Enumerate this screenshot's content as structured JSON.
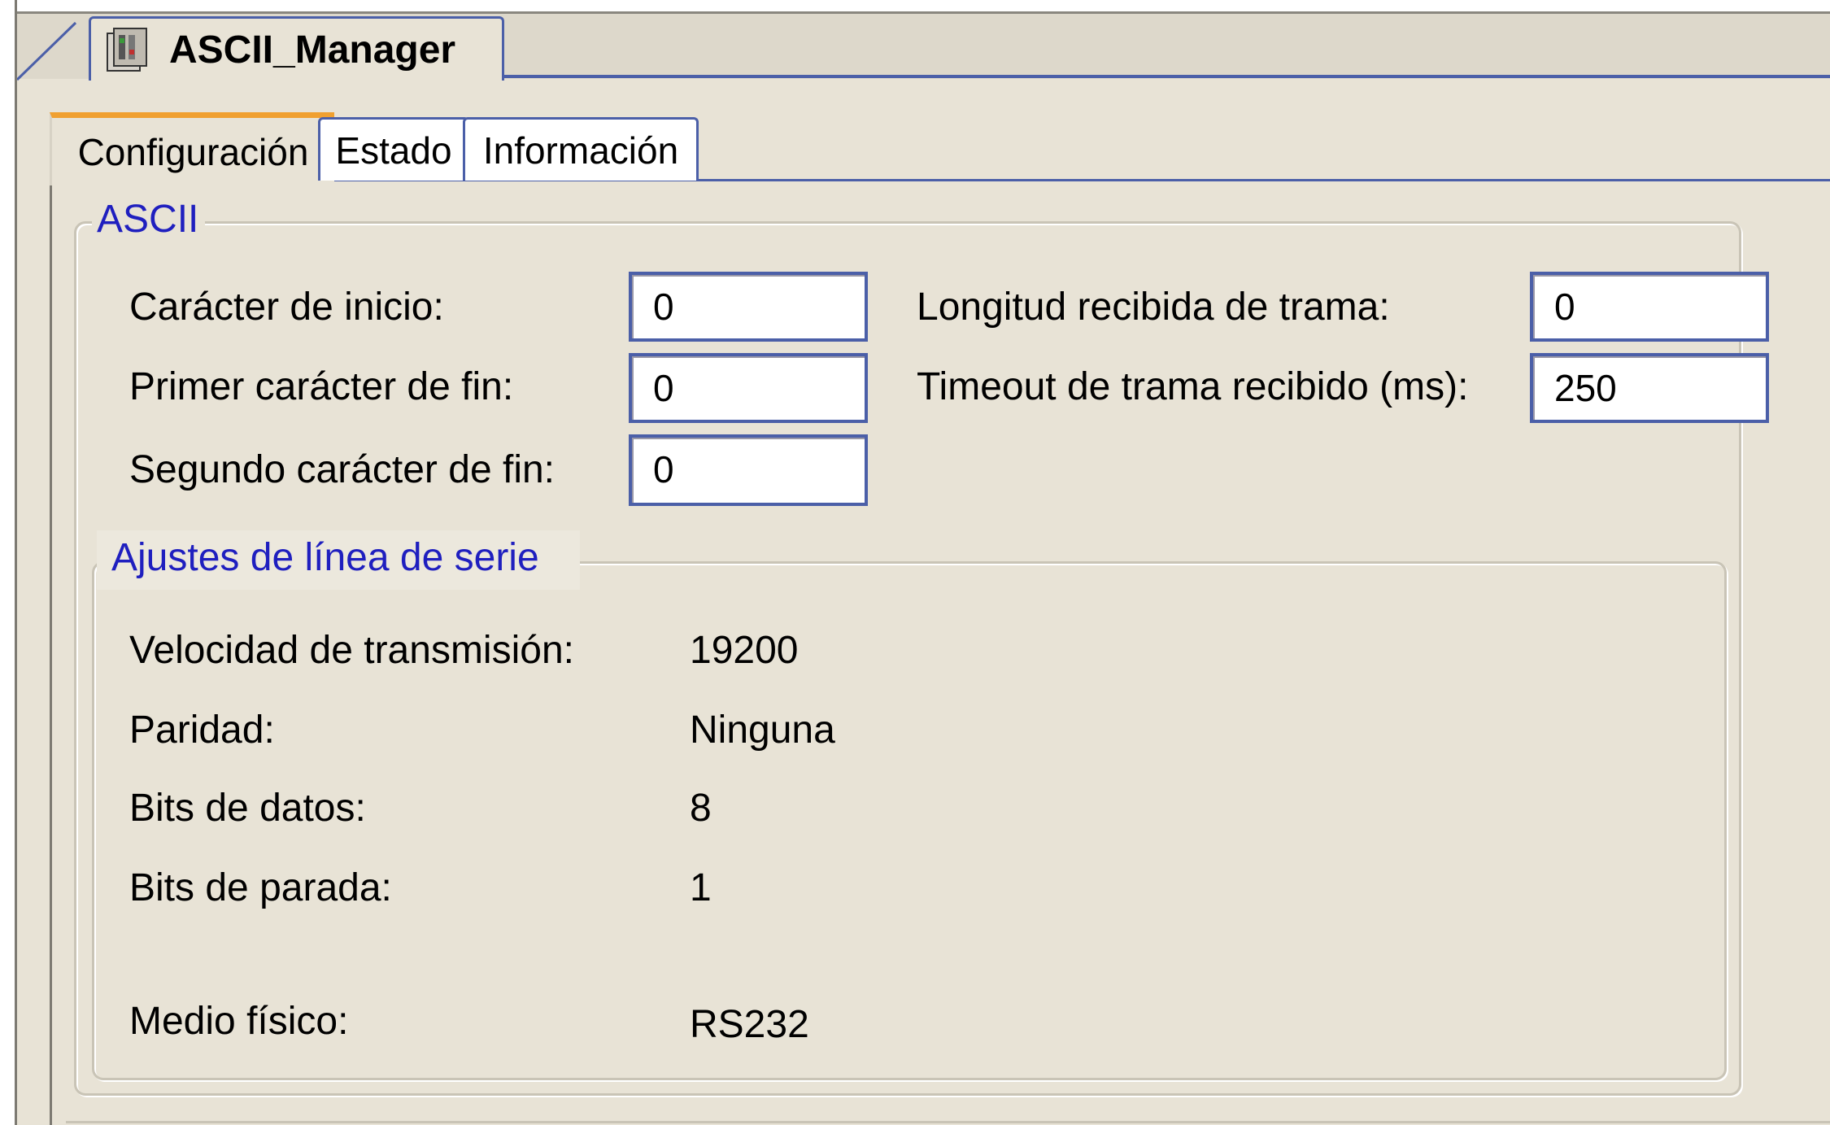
{
  "editor_tab": {
    "title": "ASCII_Manager",
    "icon": "module-icon"
  },
  "tabs": [
    {
      "label": "Configuración",
      "active": true
    },
    {
      "label": "Estado",
      "active": false
    },
    {
      "label": "Información",
      "active": false
    }
  ],
  "ascii": {
    "legend": "ASCII",
    "start_char": {
      "label": "Carácter de inicio:",
      "value": "0"
    },
    "first_end_char": {
      "label": "Primer carácter de fin:",
      "value": "0"
    },
    "second_end_char": {
      "label": "Segundo carácter de fin:",
      "value": "0"
    },
    "frame_length": {
      "label": "Longitud recibida de trama:",
      "value": "0"
    },
    "frame_timeout": {
      "label": "Timeout de trama recibido (ms):",
      "value": "250"
    }
  },
  "serial": {
    "legend": "Ajustes de línea de serie",
    "baud_rate": {
      "label": "Velocidad de transmisión:",
      "value": "19200"
    },
    "parity": {
      "label": "Paridad:",
      "value": "Ninguna"
    },
    "data_bits": {
      "label": "Bits de datos:",
      "value": "8"
    },
    "stop_bits": {
      "label": "Bits de parada:",
      "value": "1"
    },
    "physical_medium": {
      "label": "Medio físico:",
      "value": "RS232"
    }
  },
  "colors": {
    "accent": "#4b5fa8",
    "legend_text": "#1f1fbf",
    "active_tab_marker": "#f0a030",
    "panel_bg": "#e8e3d6"
  }
}
